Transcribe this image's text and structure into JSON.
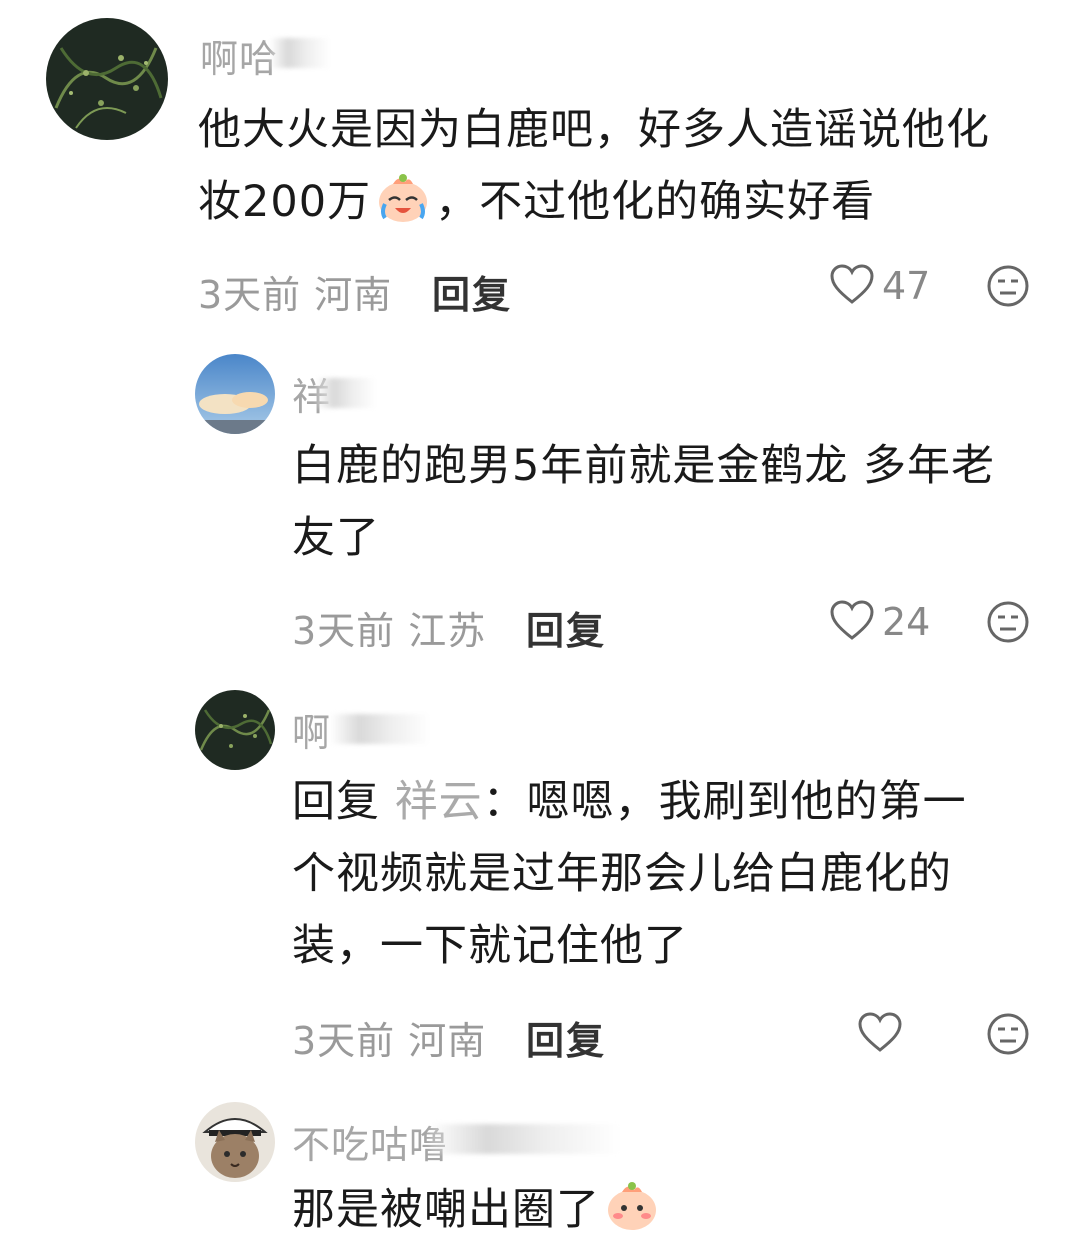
{
  "comments": [
    {
      "username": "啊哈",
      "text_line1": "他大火是因为白鹿吧，好多人造谣说他化",
      "text_line2_a": "妆200万",
      "text_line2_b": "，不过他化的确实好看",
      "time": "3天前",
      "location": "河南",
      "reply_label": "回复",
      "likes": "47"
    },
    {
      "username": "祥",
      "text_line1": "白鹿的跑男5年前就是金鹤龙 多年老",
      "text_line2": "友了",
      "time": "3天前",
      "location": "江苏",
      "reply_label": "回复",
      "likes": "24"
    },
    {
      "username": "啊",
      "reply_prefix": "回复",
      "reply_to": "祥云",
      "text_line1_rest": "：嗯嗯，我刷到他的第一",
      "text_line2": "个视频就是过年那会儿给白鹿化的",
      "text_line3": "装，一下就记住他了",
      "time": "3天前",
      "location": "河南",
      "reply_label": "回复",
      "likes": ""
    },
    {
      "username": "不吃咕噜",
      "text_line1": "那是被嘲出圈了"
    }
  ]
}
